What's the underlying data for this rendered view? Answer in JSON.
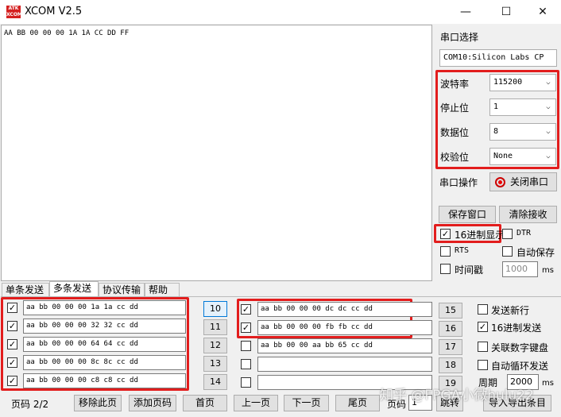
{
  "window": {
    "title": "XCOM V2.5",
    "logo_text": "ATK\nXCOM",
    "minimize": "—",
    "maximize": "☐",
    "close": "✕"
  },
  "receive": {
    "content": "AA BB 00 00 00 1A 1A CC DD FF"
  },
  "serial": {
    "section_label": "串口选择",
    "port_value": "COM10:Silicon Labs CP",
    "baud_label": "波特率",
    "baud_value": "115200",
    "stop_label": "停止位",
    "stop_value": "1",
    "data_label": "数据位",
    "data_value": "8",
    "parity_label": "校验位",
    "parity_value": "None",
    "op_label": "串口操作",
    "open_close_button": "关闭串口"
  },
  "actions": {
    "save_window": "保存窗口",
    "clear_receive": "清除接收"
  },
  "options": {
    "hex_display": {
      "label": "16进制显示",
      "checked": true
    },
    "dtr": {
      "label": "DTR",
      "checked": false
    },
    "rts": {
      "label": "RTS",
      "checked": false
    },
    "auto_save": {
      "label": "自动保存",
      "checked": false
    },
    "timestamp": {
      "label": "时间戳",
      "checked": false
    },
    "timestamp_value": "1000",
    "timestamp_unit": "ms"
  },
  "tabs": [
    {
      "label": "单条发送"
    },
    {
      "label": "多条发送"
    },
    {
      "label": "协议传输"
    },
    {
      "label": "帮助"
    }
  ],
  "multi_send": {
    "left": [
      {
        "checked": true,
        "text": "aa bb 00 00 00 1a 1a cc dd",
        "button": "10"
      },
      {
        "checked": true,
        "text": "aa bb 00 00 00 32 32 cc dd",
        "button": "11"
      },
      {
        "checked": true,
        "text": "aa bb 00 00 00 64 64 cc dd",
        "button": "12"
      },
      {
        "checked": true,
        "text": "aa bb 00 00 00 8c 8c cc dd",
        "button": "13"
      },
      {
        "checked": true,
        "text": "aa bb 00 00 00 c8 c8 cc dd",
        "button": "14"
      }
    ],
    "right": [
      {
        "checked": true,
        "text": "aa bb 00 00 00 dc dc cc dd",
        "button": "15"
      },
      {
        "checked": true,
        "text": "aa bb 00 00 00 fb fb cc dd",
        "button": "16"
      },
      {
        "checked": false,
        "text": "aa bb 00 00 aa bb 65 cc dd",
        "button": "17"
      },
      {
        "checked": false,
        "text": "",
        "button": "18"
      },
      {
        "checked": false,
        "text": "",
        "button": "19"
      }
    ],
    "send_newline": {
      "label": "发送新行",
      "checked": false
    },
    "hex_send": {
      "label": "16进制发送",
      "checked": true
    },
    "link_keypad": {
      "label": "关联数字键盘",
      "checked": false
    },
    "auto_loop": {
      "label": "自动循环发送",
      "checked": false
    },
    "period_label": "周期",
    "period_value": "2000",
    "period_unit": "ms"
  },
  "pager": {
    "page_info": "页码 2/2",
    "remove_page": "移除此页",
    "add_page": "添加页码",
    "first": "首页",
    "prev": "上一页",
    "next": "下一页",
    "last": "尾页",
    "page_label": "页码",
    "page_value": "1",
    "jump": "跳转",
    "import_export": "导入导出条目"
  },
  "watermark": "知乎 @FPGA小微hulu22",
  "colors": {
    "highlight_red": "#e21d1d"
  }
}
